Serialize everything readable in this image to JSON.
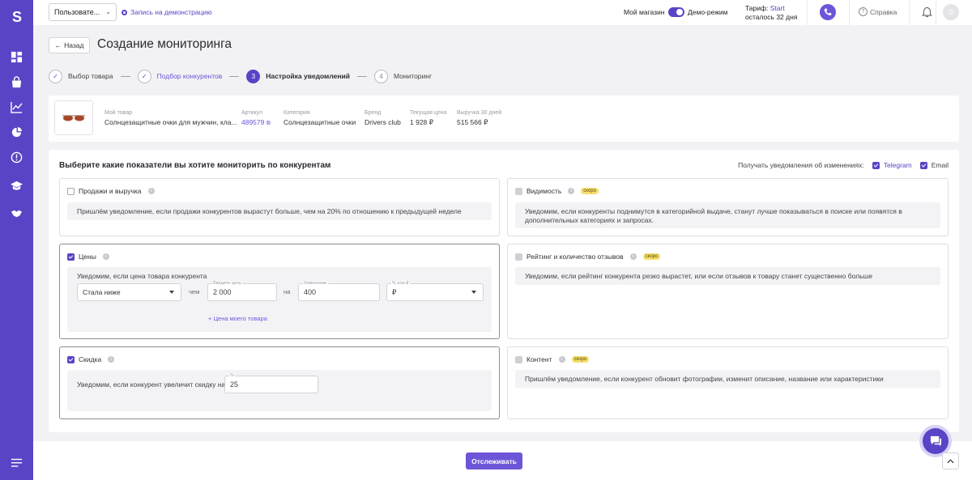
{
  "sidebar": {
    "logo": "S",
    "icons": [
      "dashboard-icon",
      "bag-icon",
      "chart-icon",
      "pie-icon",
      "alert-icon",
      "graduation-icon",
      "handshake-icon",
      "menu-icon"
    ]
  },
  "topbar": {
    "user_select": "Пользовате...",
    "demo_record": "Запись на демонстрацию",
    "my_shop": "Мой магазин",
    "demo_mode": "Демо-режим",
    "tariff_prefix": "Тариф: ",
    "tariff_name": "Start",
    "tariff_days": "осталось 32 дня",
    "help": "Справка",
    "avatar": "S"
  },
  "header": {
    "back": "Назад",
    "title": "Создание мониторинга"
  },
  "stepper": [
    {
      "num": "✓",
      "label": "Выбор товара",
      "state": "done"
    },
    {
      "num": "✓",
      "label": "Подбор конкурентов",
      "state": "done-link"
    },
    {
      "num": "3",
      "label": "Настройка уведомлений",
      "state": "active"
    },
    {
      "num": "4",
      "label": "Мониторинг",
      "state": "todo"
    }
  ],
  "product": {
    "my_product_label": "Мой товар",
    "my_product_value": "Солнцезащитные очки для мужчин, кла...",
    "article_label": "Артикул",
    "article_value": "489579",
    "category_label": "Категория",
    "category_value": "Солнцезащитные очки",
    "brand_label": "Бренд",
    "brand_value": "Drivers club",
    "price_label": "Текущая цена",
    "price_value": "1 928 ₽",
    "revenue_label": "Выручка 30 дней",
    "revenue_value": "515 566 ₽"
  },
  "panel": {
    "title": "Выберите какие показатели вы хотите мониторить по конкурентам",
    "notify_label": "Получать уведомления об изменениях:",
    "telegram": "Telegram",
    "email": "Email",
    "soon": "скоро"
  },
  "boxes": {
    "sales": {
      "title": "Продажи и выручка",
      "text": "Пришлём уведомление, если продажи конкурентов вырастут больше, чем на 20% по отношению к предыдущей неделе"
    },
    "visibility": {
      "title": "Видимость",
      "text": "Уведомим, если конкуренты поднимутся в категорийной выдаче, станут лучше показываться в поиске или появятся в дополнительных категориях и запросах."
    },
    "prices": {
      "title": "Цены",
      "intro": "Уведомим, если цена товара конкурента",
      "condition": "Стала ниже",
      "than": "чем",
      "price_label": "Введите цену",
      "price_value": "2 000",
      "by": "на",
      "change_label": "Изменение",
      "change_value": "400",
      "unit_label": "% или ₽",
      "unit_value": "₽",
      "my_price_link": "Цена моего товара"
    },
    "rating": {
      "title": "Рейтинг и количество отзывов",
      "text": "Уведомим, если рейтинг конкурента резко вырастет, или если отзывов к товару станет существенно больше"
    },
    "discount": {
      "title": "Скидка",
      "text": "Уведомим, если конкурент увеличит скидку на",
      "field_label": "%",
      "field_value": "25"
    },
    "content": {
      "title": "Контент",
      "text": "Пришлём уведомление, если конкурент обновит фотографии, изменит описание, название или характеристики"
    }
  },
  "footer": {
    "track": "Отслеживать"
  }
}
